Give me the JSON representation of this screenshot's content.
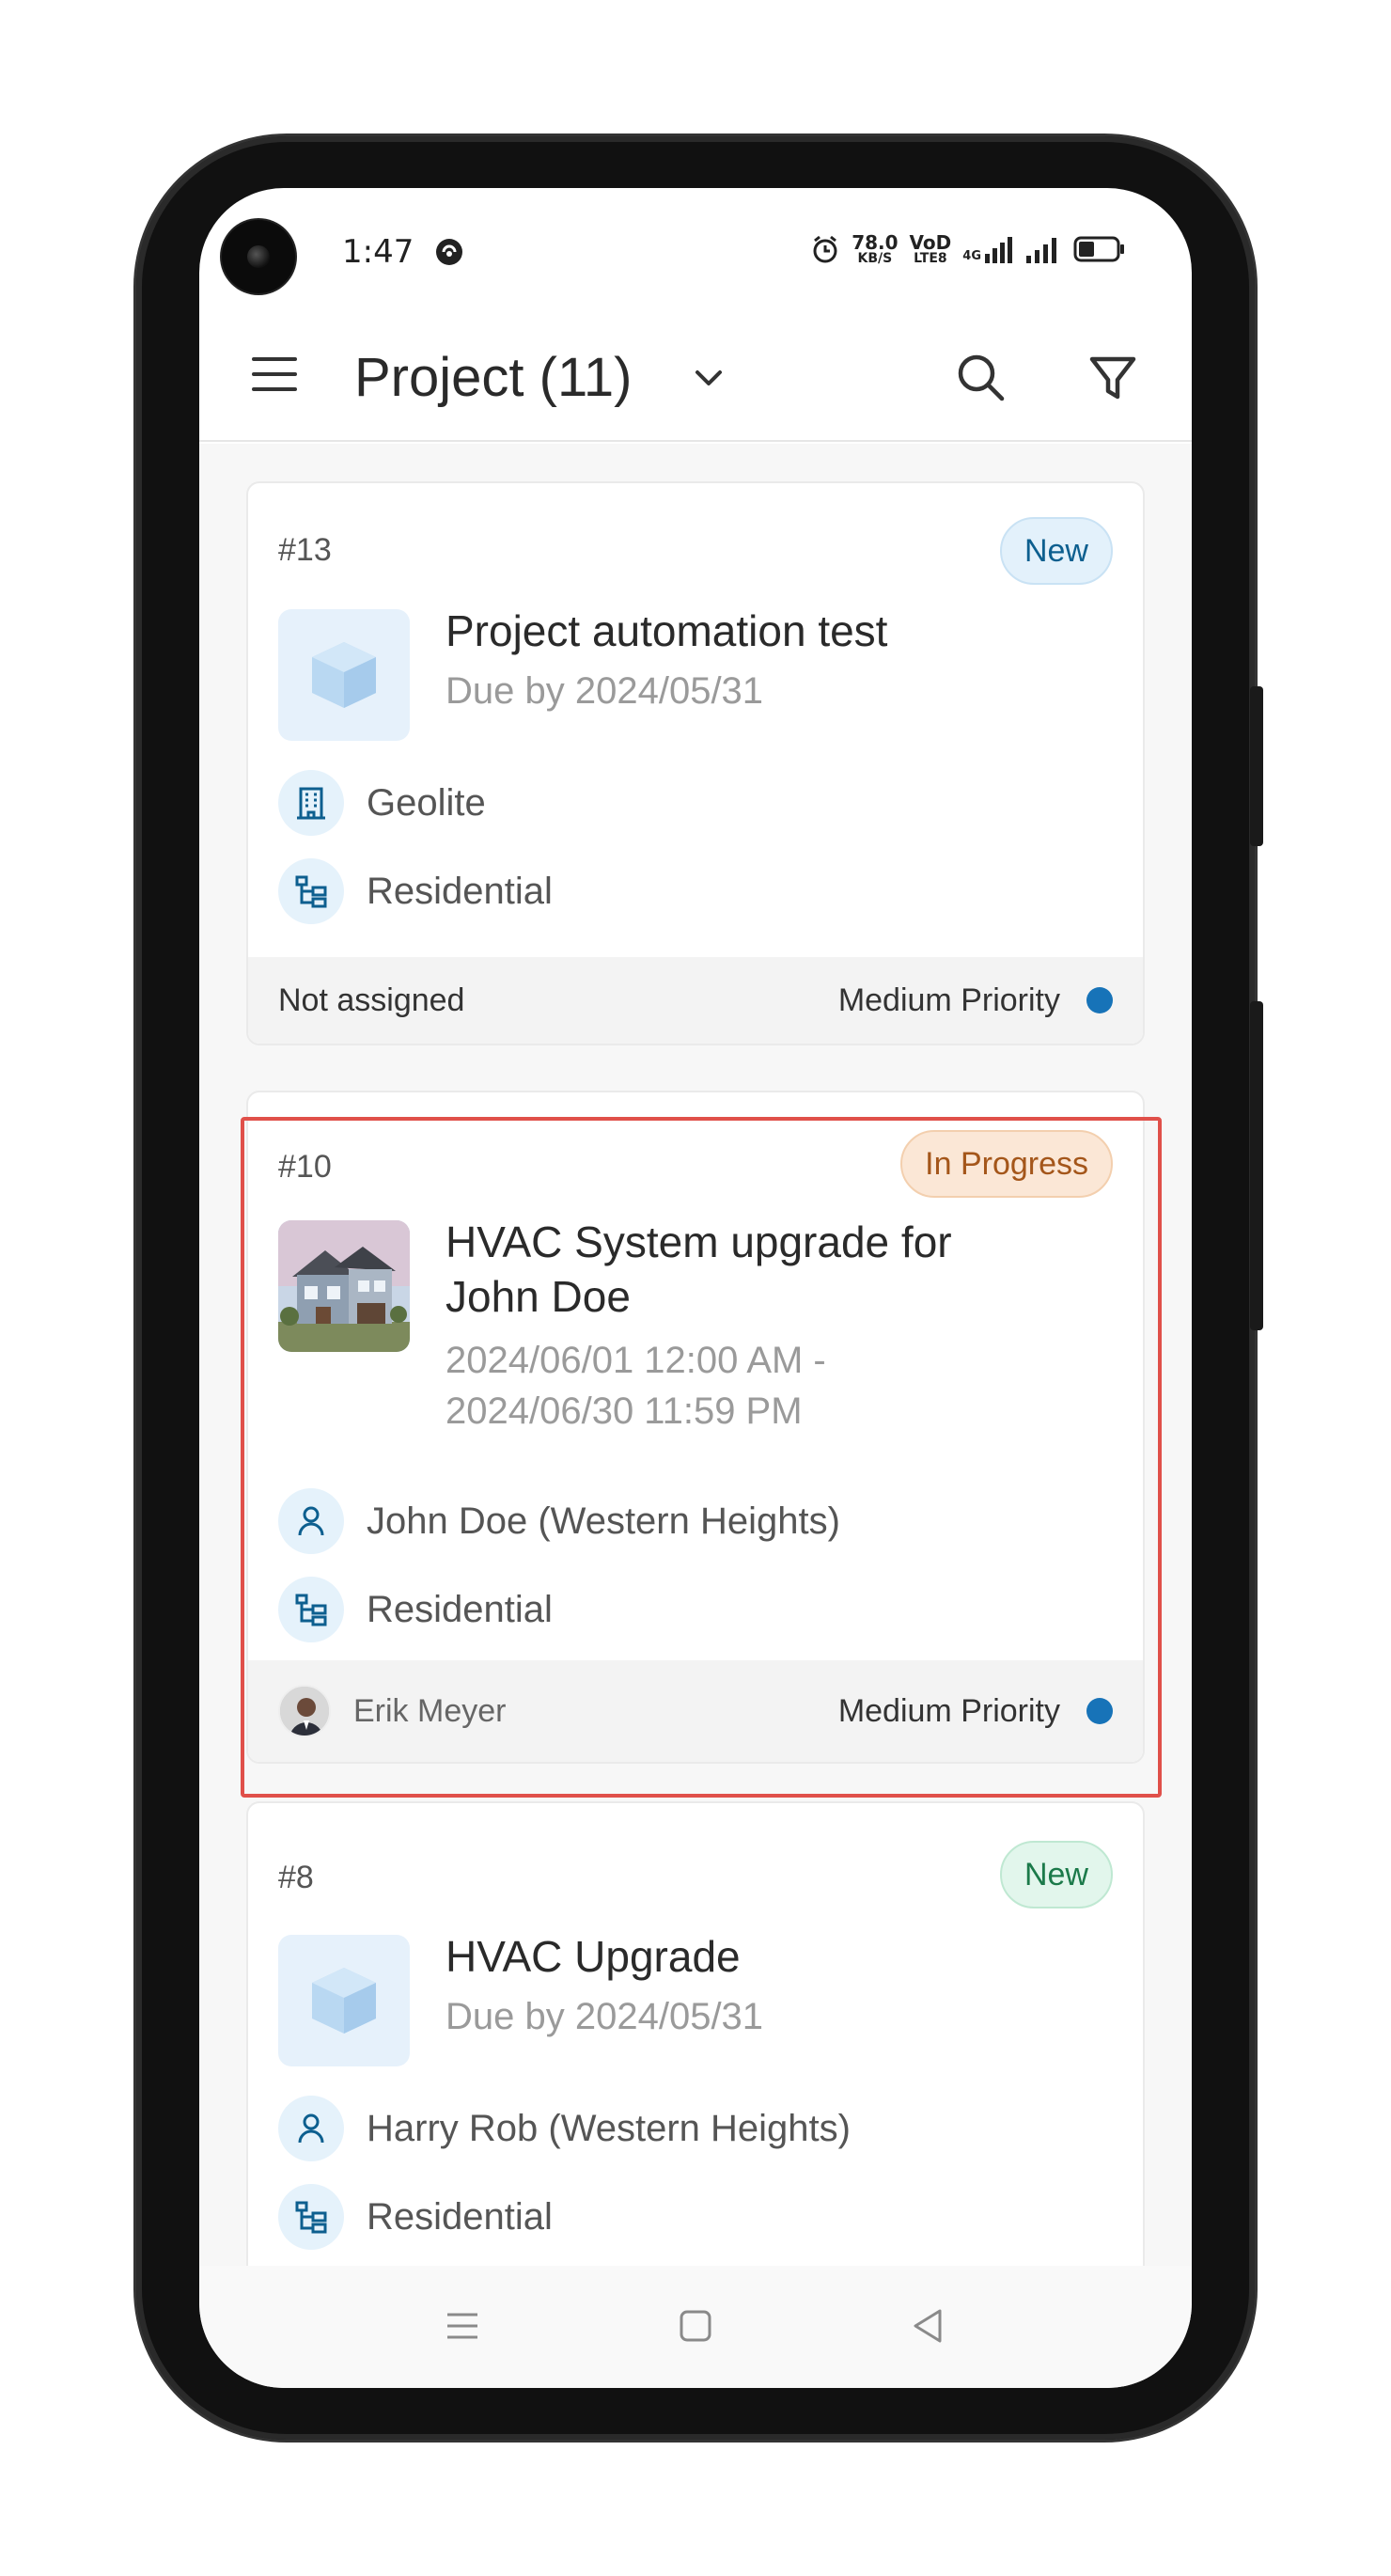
{
  "status_bar": {
    "time": "1:47",
    "net_speed_value": "78.0",
    "net_speed_unit": "KB/S",
    "volte_top": "VoD",
    "volte_bottom": "LTE8",
    "network_type": "4G"
  },
  "header": {
    "title": "Project (11)"
  },
  "projects": [
    {
      "number": "#13",
      "status": "New",
      "title": "Project automation test",
      "subtitle": "Due by 2024/05/31",
      "meta1": "Geolite",
      "meta2": "Residential",
      "assignee": "Not assigned",
      "priority": "Medium Priority"
    },
    {
      "number": "#10",
      "status": "In Progress",
      "title_line1": "HVAC System upgrade for",
      "title_line2": "John Doe",
      "subtitle_line1": "2024/06/01 12:00 AM -",
      "subtitle_line2": "2024/06/30 11:59 PM",
      "meta1": "John  Doe (Western Heights)",
      "meta2": "Residential",
      "assignee": "Erik Meyer",
      "priority": "Medium Priority"
    },
    {
      "number": "#8",
      "status": "New",
      "title": "HVAC Upgrade",
      "subtitle": "Due by 2024/05/31",
      "meta1": "Harry Rob (Western Heights)",
      "meta2": "Residential"
    }
  ],
  "colors": {
    "accent": "#1773b8",
    "highlight": "#e0504a",
    "badge_new": "#0d5f8f",
    "badge_new_green": "#1b7a4a",
    "badge_progress": "#a4561a"
  }
}
